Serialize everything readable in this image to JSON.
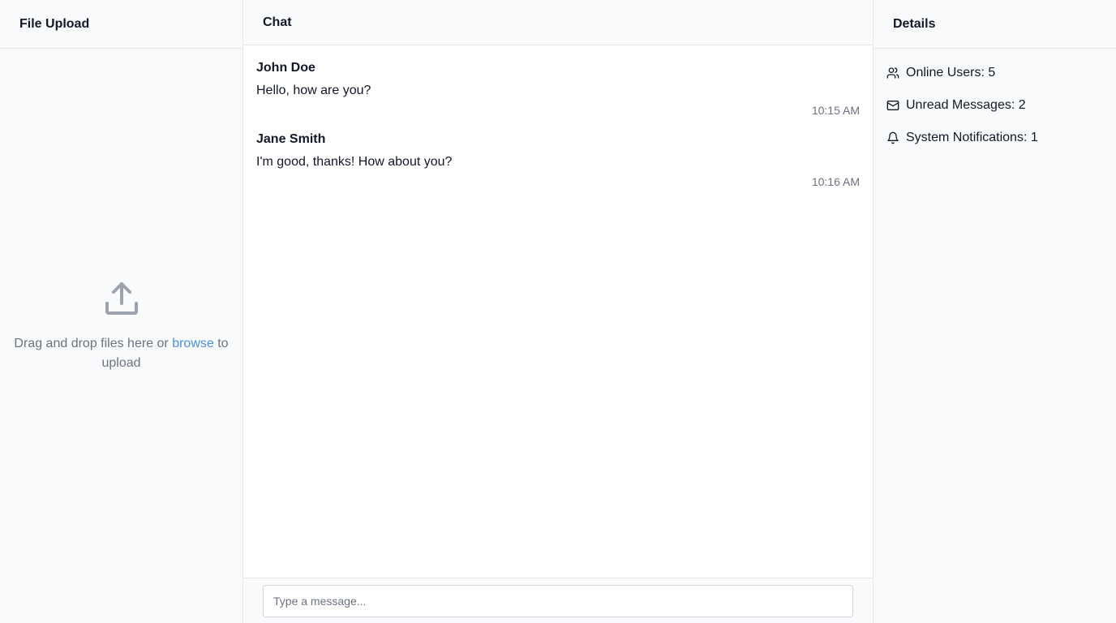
{
  "left_panel": {
    "title": "File Upload",
    "dropzone": {
      "text_before": "Drag and drop files here or ",
      "link": "browse",
      "text_after": " to upload",
      "icon": "upload-icon"
    }
  },
  "chat": {
    "title": "Chat",
    "messages": [
      {
        "author": "John Doe",
        "text": "Hello, how are you?",
        "time": "10:15 AM"
      },
      {
        "author": "Jane Smith",
        "text": "I'm good, thanks! How about you?",
        "time": "10:16 AM"
      }
    ],
    "input": {
      "placeholder": "Type a message...",
      "value": ""
    }
  },
  "details": {
    "title": "Details",
    "items": [
      {
        "icon": "users-icon",
        "label": "Online Users: 5"
      },
      {
        "icon": "mail-icon",
        "label": "Unread Messages: 2"
      },
      {
        "icon": "bell-icon",
        "label": "System Notifications: 1"
      }
    ]
  },
  "colors": {
    "panel_bg": "#f9fafb",
    "border": "#e5e7eb",
    "link": "#4a90e2",
    "muted_text": "#6b7280"
  }
}
